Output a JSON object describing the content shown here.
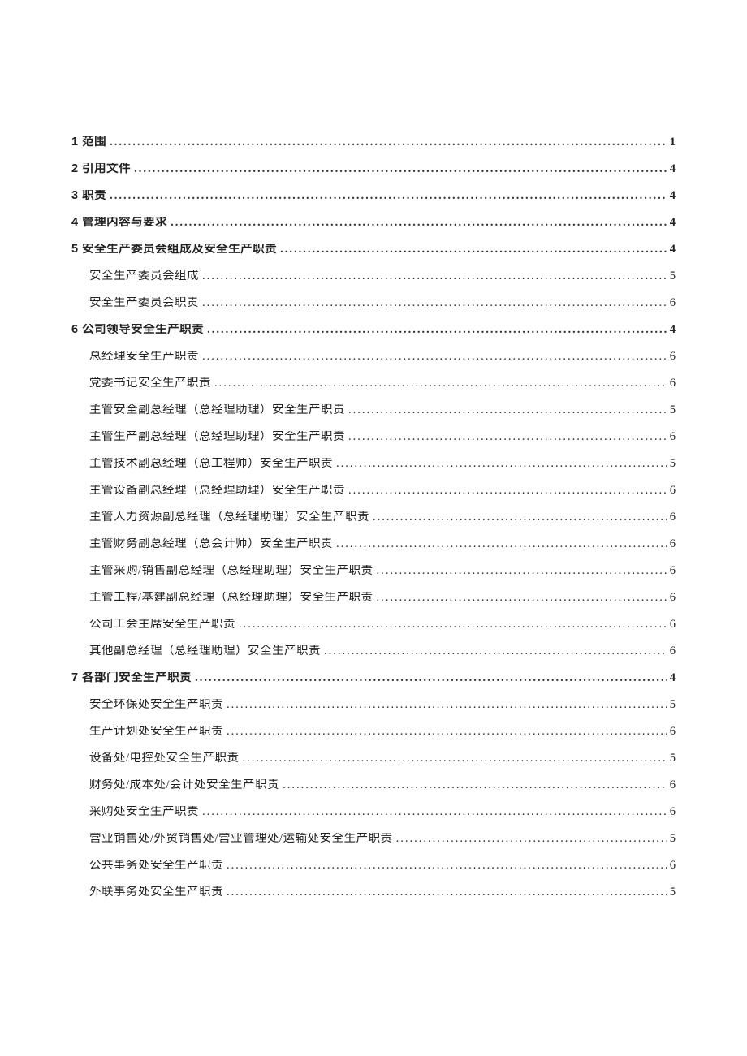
{
  "toc": [
    {
      "level": 1,
      "title": "1 范围",
      "page": "1"
    },
    {
      "level": 1,
      "title": "2 引用文件",
      "page": "4"
    },
    {
      "level": 1,
      "title": "3 职责",
      "page": "4"
    },
    {
      "level": 1,
      "title": "4 管理内容与要求",
      "page": "4"
    },
    {
      "level": 1,
      "title": "5 安全生产委员会组成及安全生产职责",
      "page": "4"
    },
    {
      "level": 2,
      "title": "安全生产委员会组成",
      "page": "5"
    },
    {
      "level": 2,
      "title": "安全生产委员会职责",
      "page": "6"
    },
    {
      "level": 1,
      "title": "6 公司领导安全生产职责",
      "page": "4"
    },
    {
      "level": 2,
      "title": "总经理安全生产职责",
      "page": "6"
    },
    {
      "level": 2,
      "title": "党委书记安全生产职责",
      "page": "6"
    },
    {
      "level": 2,
      "title": "主管安全副总经理（总经理助理）安全生产职责",
      "page": "5"
    },
    {
      "level": 2,
      "title": "主管生产副总经理（总经理助理）安全生产职责",
      "page": "6"
    },
    {
      "level": 2,
      "title": "主管技术副总经理（总工程师）安全生产职责",
      "page": "5"
    },
    {
      "level": 2,
      "title": "主管设备副总经理（总经理助理）安全生产职责",
      "page": "6"
    },
    {
      "level": 2,
      "title": "主管人力资源副总经理（总经理助理）安全生产职责",
      "page": "6"
    },
    {
      "level": 2,
      "title": "主管财务副总经理（总会计师）安全生产职责",
      "page": "6"
    },
    {
      "level": 2,
      "title": "主管采购/销售副总经理（总经理助理）安全生产职责",
      "page": "6"
    },
    {
      "level": 2,
      "title": "主管工程/基建副总经理（总经理助理）安全生产职责",
      "page": "6"
    },
    {
      "level": 2,
      "title": "公司工会主席安全生产职责",
      "page": "6"
    },
    {
      "level": 2,
      "title": "其他副总经理（总经理助理）安全生产职责",
      "page": "6"
    },
    {
      "level": 1,
      "title": "7 各部门安全生产职责",
      "page": "4"
    },
    {
      "level": 2,
      "title": "安全环保处安全生产职责",
      "page": "5"
    },
    {
      "level": 2,
      "title": "生产计划处安全生产职责",
      "page": "6"
    },
    {
      "level": 2,
      "title": "设备处/电控处安全生产职责",
      "page": "5"
    },
    {
      "level": 2,
      "title": "财务处/成本处/会计处安全生产职责",
      "page": "6"
    },
    {
      "level": 2,
      "title": "采购处安全生产职责",
      "page": "6"
    },
    {
      "level": 2,
      "title": "营业销售处/外贸销售处/营业管理处/运输处安全生产职责",
      "page": "5"
    },
    {
      "level": 2,
      "title": "公共事务处安全生产职责",
      "page": "6"
    },
    {
      "level": 2,
      "title": "外联事务处安全生产职责",
      "page": "5"
    }
  ]
}
